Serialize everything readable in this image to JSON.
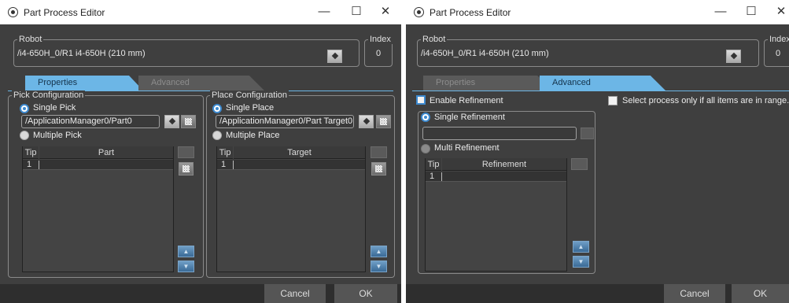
{
  "left": {
    "title": "Part Process Editor",
    "controls": {
      "minimize": "—",
      "maximize": "☐",
      "close": "✕"
    },
    "robot_legend": "Robot",
    "robot_path": "/i4-650H_0/R1 i4-650H (210 mm)",
    "index_legend": "Index",
    "index_value": "0",
    "tabs": [
      "Properties",
      "Advanced"
    ],
    "active_tab": "Properties",
    "pick": {
      "legend": "Pick Configuration",
      "single_label": "Single Pick",
      "single_selected": true,
      "path": "/ApplicationManager0/Part0",
      "multiple_label": "Multiple Pick",
      "columns": [
        "Tip",
        "Part"
      ],
      "rows": [
        [
          "1",
          ""
        ]
      ]
    },
    "place": {
      "legend": "Place Configuration",
      "single_label": "Single Place",
      "single_selected": true,
      "path": "/ApplicationManager0/Part Target0",
      "multiple_label": "Multiple Place",
      "columns": [
        "Tip",
        "Target"
      ],
      "rows": [
        [
          "1",
          ""
        ]
      ]
    },
    "buttons": {
      "cancel": "Cancel",
      "ok": "OK"
    }
  },
  "right": {
    "title": "Part Process Editor",
    "controls": {
      "minimize": "—",
      "maximize": "☐",
      "close": "✕"
    },
    "robot_legend": "Robot",
    "robot_path": "/i4-650H_0/R1 i4-650H (210 mm)",
    "index_legend": "Index",
    "index_value": "0",
    "tabs": [
      "Properties",
      "Advanced"
    ],
    "active_tab": "Advanced",
    "enable_refinement_label": "Enable Refinement",
    "enable_refinement_checked": false,
    "select_process_label": "Select process only if all items are in range.",
    "select_process_checked": false,
    "single_refinement_label": "Single Refinement",
    "single_refinement_selected": true,
    "refinement_value": "",
    "multi_refinement_label": "Multi Refinement",
    "columns": [
      "Tip",
      "Refinement"
    ],
    "rows": [
      [
        "1",
        ""
      ]
    ],
    "buttons": {
      "cancel": "Cancel",
      "ok": "OK"
    }
  },
  "colors": {
    "accent": "#6cb6e6",
    "panel": "#3f3f3f",
    "radio_blue": "#3d8ad0"
  }
}
